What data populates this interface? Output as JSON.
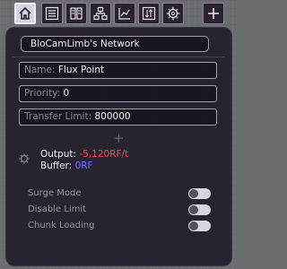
{
  "tabs": [
    {
      "name": "home-icon",
      "active": true
    },
    {
      "name": "list-icon",
      "active": false
    },
    {
      "name": "storage-icon",
      "active": false
    },
    {
      "name": "network-tree-icon",
      "active": false
    },
    {
      "name": "chart-icon",
      "active": false
    },
    {
      "name": "sort-icon",
      "active": false
    },
    {
      "name": "gear-icon",
      "active": false
    },
    {
      "name": "add-icon",
      "active": false
    }
  ],
  "network_title": "BloCamLimb's Network",
  "fields": {
    "name_label": "Name:",
    "name_value": "Flux Point",
    "priority_label": "Priority:",
    "priority_value": "0",
    "transfer_label": "Transfer Limit:",
    "transfer_value": "800000"
  },
  "stats": {
    "output_label": "Output:",
    "output_value": "-5,120RF/t",
    "buffer_label": "Buffer:",
    "buffer_value": "0RF"
  },
  "settings": [
    {
      "label": "Surge Mode",
      "on": false
    },
    {
      "label": "Disable Limit",
      "on": false
    },
    {
      "label": "Chunk Loading",
      "on": false
    }
  ],
  "colors": {
    "accent": "#a59bb4",
    "output_value": "#e85050",
    "buffer_value": "#6b6cff",
    "tab_active": "#d8d2e6"
  }
}
